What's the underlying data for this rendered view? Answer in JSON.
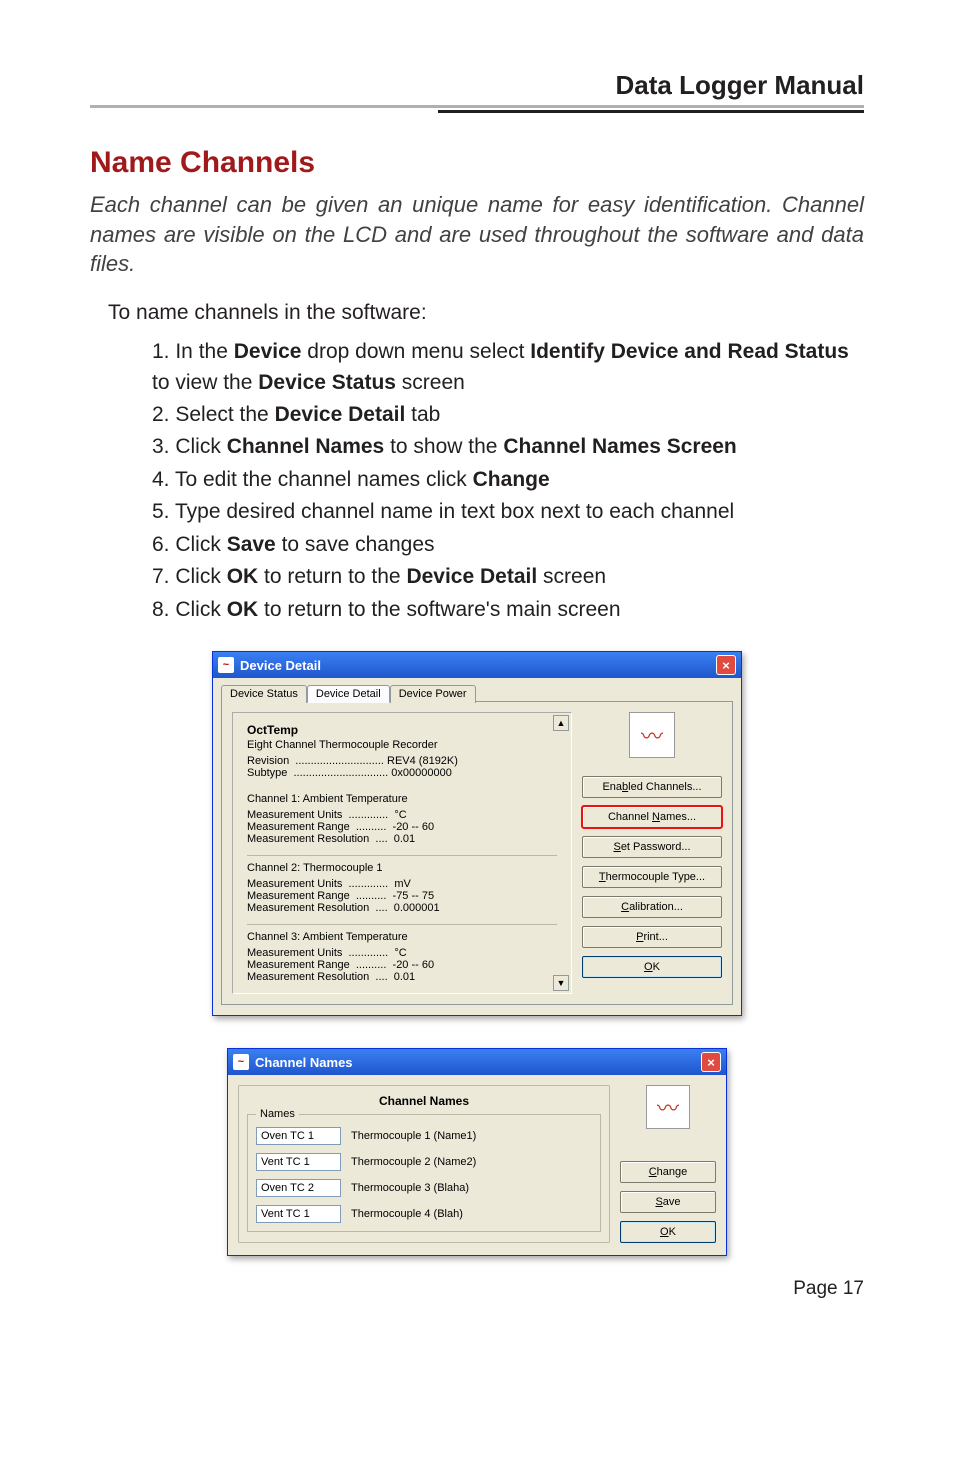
{
  "header": {
    "title": "Data Logger Manual"
  },
  "section": {
    "title": "Name Channels"
  },
  "intro": "Each channel can be given an unique name for easy identification. Channel names are visible on the LCD and are used throughout the software and data files.",
  "lead": "To name channels in the software:",
  "steps": {
    "s1a": "1. In the ",
    "s1b": "Device",
    "s1c": " drop down menu select ",
    "s1d": "Identify Device and Read Status",
    "s1e": " to view the ",
    "s1f": "Device Status",
    "s1g": " screen",
    "s2a": "2. Select the ",
    "s2b": "Device Detail",
    "s2c": " tab",
    "s3a": "3. Click ",
    "s3b": "Channel Names",
    "s3c": " to show the ",
    "s3d": "Channel Names Screen",
    "s4a": "4. To edit the channel names click ",
    "s4b": "Change",
    "s5": "5. Type desired channel name in text box next to each channel",
    "s6a": "6. Click ",
    "s6b": "Save",
    "s6c": " to save changes",
    "s7a": "7. Click ",
    "s7b": "OK",
    "s7c": " to return to the ",
    "s7d": "Device Detail",
    "s7e": " screen",
    "s8a": "8. Click ",
    "s8b": "OK",
    "s8c": " to return to the software's main screen"
  },
  "deviceDetail": {
    "title": "Device Detail",
    "tabs": [
      "Device Status",
      "Device Detail",
      "Device Power"
    ],
    "device": {
      "name": "OctTemp",
      "desc": "Eight Channel Thermocouple Recorder",
      "revision_label": "Revision",
      "revision": "REV4 (8192K)",
      "subtype_label": "Subtype",
      "subtype": "0x00000000"
    },
    "channels": [
      {
        "title": "Channel 1: Ambient Temperature",
        "units": "°C",
        "range": "-20 -- 60",
        "resolution": "0.01"
      },
      {
        "title": "Channel 2: Thermocouple  1",
        "units": "mV",
        "range": "-75 -- 75",
        "resolution": "0.000001"
      },
      {
        "title": "Channel 3: Ambient Temperature",
        "units": "°C",
        "range": "-20 -- 60",
        "resolution": "0.01"
      }
    ],
    "labels": {
      "units": "Measurement Units  .............",
      "range": "Measurement Range  ..........",
      "res": "Measurement Resolution  ....",
      "rev_dots": "  .............................",
      "sub_dots": "  ..............................."
    },
    "buttons": {
      "enabled_pre": "Ena",
      "enabled_u": "b",
      "enabled_post": "led Channels...",
      "names_pre": "Channel ",
      "names_u": "N",
      "names_post": "ames...",
      "pwd_u": "S",
      "pwd_post": "et Password...",
      "thermo_u": "T",
      "thermo_post": "hermocouple Type...",
      "cal_u": "C",
      "cal_post": "alibration...",
      "print_u": "P",
      "print_post": "rint...",
      "ok_u": "O",
      "ok_post": "K"
    }
  },
  "channelNames": {
    "title": "Channel Names",
    "heading": "Channel Names",
    "legend": "Names",
    "rows": [
      {
        "value": "Oven TC 1",
        "label": "Thermocouple  1 (Name1)"
      },
      {
        "value": "Vent TC 1",
        "label": "Thermocouple  2 (Name2)"
      },
      {
        "value": "Oven TC 2",
        "label": "Thermocouple  3 (Blaha)"
      },
      {
        "value": "Vent TC 1",
        "label": "Thermocouple  4 (Blah)"
      }
    ],
    "buttons": {
      "change_u": "C",
      "change_post": "hange",
      "save_u": "S",
      "save_post": "ave",
      "ok_u": "O",
      "ok_post": "K"
    }
  },
  "footer": {
    "page": "Page 17"
  }
}
